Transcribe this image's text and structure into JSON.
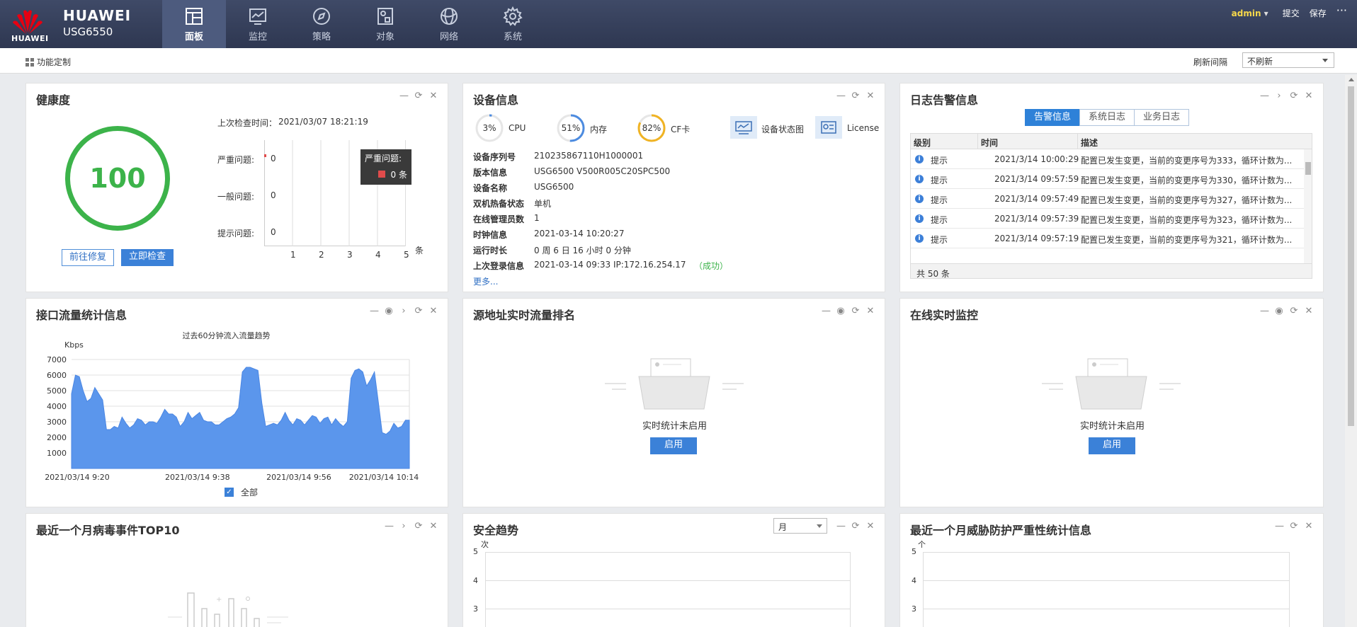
{
  "header": {
    "brand_logo": "HUAWEI",
    "brand_name": "HUAWEI",
    "model": "USG6550",
    "nav": [
      {
        "label": "面板",
        "icon": "dashboard-icon"
      },
      {
        "label": "监控",
        "icon": "monitor-icon"
      },
      {
        "label": "策略",
        "icon": "compass-icon"
      },
      {
        "label": "对象",
        "icon": "object-icon"
      },
      {
        "label": "网络",
        "icon": "globe-icon"
      },
      {
        "label": "系统",
        "icon": "gear-icon"
      }
    ],
    "user": "admin",
    "submit": "提交",
    "save": "保存",
    "more": "···"
  },
  "toolbar": {
    "customize": "功能定制",
    "refresh_label": "刷新间隔",
    "refresh_value": "不刷新"
  },
  "health": {
    "title": "健康度",
    "score": "100",
    "last_check_label": "上次检查时间：",
    "last_check": "2021/03/07 18:21:19",
    "rows": [
      {
        "label": "严重问题:",
        "count": "0"
      },
      {
        "label": "一般问题:",
        "count": "0"
      },
      {
        "label": "提示问题:",
        "count": "0"
      }
    ],
    "axis": [
      "1",
      "2",
      "3",
      "4",
      "5"
    ],
    "axis_unit": "条",
    "tooltip_title": "严重问题:",
    "tooltip_value": "0 条",
    "fix_button": "前往修复",
    "check_button": "立即检查"
  },
  "device": {
    "title": "设备信息",
    "cpu": {
      "value": "3%",
      "label": "CPU",
      "pct": 3
    },
    "mem": {
      "value": "51%",
      "label": "内存",
      "pct": 51
    },
    "cf": {
      "value": "82%",
      "label": "CF卡",
      "pct": 82
    },
    "status_label": "设备状态图",
    "license_label": "License",
    "rows": [
      {
        "k": "设备序列号",
        "v": "210235867110H1000001"
      },
      {
        "k": "版本信息",
        "v": "USG6500 V500R005C20SPC500"
      },
      {
        "k": "设备名称",
        "v": "USG6500"
      },
      {
        "k": "双机热备状态",
        "v": "单机"
      },
      {
        "k": "在线管理员数",
        "v": "1"
      },
      {
        "k": "时钟信息",
        "v": "2021-03-14 10:20:27"
      },
      {
        "k": "运行时长",
        "v": "0 周 6 日 16 小时 0 分钟"
      },
      {
        "k": "上次登录信息",
        "v": "2021-03-14 09:33 IP:172.16.254.17"
      }
    ],
    "login_status": "（成功）",
    "more": "更多..."
  },
  "logs": {
    "title": "日志告警信息",
    "tabs": [
      "告警信息",
      "系统日志",
      "业务日志"
    ],
    "headers": [
      "级别",
      "时间",
      "描述"
    ],
    "rows": [
      {
        "level": "提示",
        "time": "2021/3/14 10:00:29",
        "desc": "配置已发生变更，当前的变更序号为333，循环计数为..."
      },
      {
        "level": "提示",
        "time": "2021/3/14 09:57:59",
        "desc": "配置已发生变更，当前的变更序号为330，循环计数为..."
      },
      {
        "level": "提示",
        "time": "2021/3/14 09:57:49",
        "desc": "配置已发生变更，当前的变更序号为327，循环计数为..."
      },
      {
        "level": "提示",
        "time": "2021/3/14 09:57:39",
        "desc": "配置已发生变更，当前的变更序号为323，循环计数为..."
      },
      {
        "level": "提示",
        "time": "2021/3/14 09:57:19",
        "desc": "配置已发生变更，当前的变更序号为321，循环计数为..."
      }
    ],
    "total": "共 50 条"
  },
  "traffic": {
    "title": "接口流量统计信息",
    "legend": "全部"
  },
  "chart_data": {
    "type": "area",
    "title": "过去60分钟流入流量趋势",
    "ylabel": "Kbps",
    "ylim": [
      0,
      7000
    ],
    "yticks": [
      "7000",
      "6000",
      "5000",
      "4000",
      "3000",
      "2000",
      "1000"
    ],
    "xticks": [
      "2021/03/14 9:20",
      "2021/03/14 9:38",
      "2021/03/14 9:56",
      "2021/03/14 10:14"
    ],
    "series": [
      {
        "name": "全部",
        "color": "#5b96ec",
        "values": [
          4800,
          6000,
          5900,
          5000,
          4300,
          4500,
          5200,
          4800,
          4400,
          2500,
          2500,
          2700,
          2600,
          3300,
          2900,
          2600,
          2800,
          3200,
          3100,
          2800,
          3000,
          3000,
          2900,
          3300,
          3800,
          3500,
          3500,
          3300,
          2700,
          3000,
          3600,
          3200,
          3400,
          3600,
          3100,
          3000,
          3000,
          2800,
          2800,
          3000,
          3200,
          3300,
          3500,
          3900,
          6200,
          6500,
          6500,
          6400,
          6300,
          4200,
          2700,
          2800,
          2900,
          2800,
          3100,
          3600,
          3100,
          2800,
          3200,
          3100,
          2800,
          3100,
          3400,
          3300,
          2900,
          3200,
          3300,
          2800,
          3200,
          2900,
          2700,
          3000,
          5800,
          6300,
          6400,
          6200,
          5300,
          5700,
          6200,
          4300,
          2300,
          2200,
          2400,
          2900,
          2600,
          2700,
          3100,
          3100
        ]
      }
    ]
  },
  "source_rank": {
    "title": "源地址实时流量排名",
    "empty_text": "实时统计未启用",
    "enable_button": "启用"
  },
  "online_monitor": {
    "title": "在线实时监控",
    "empty_text": "实时统计未启用",
    "enable_button": "启用"
  },
  "virus": {
    "title": "最近一个月病毒事件TOP10"
  },
  "security": {
    "title": "安全趋势",
    "range": "月",
    "y_unit": "次",
    "yticks": [
      "5",
      "4",
      "3"
    ]
  },
  "threat": {
    "title": "最近一个月威胁防护严重性统计信息",
    "y_unit": "个",
    "yticks": [
      "5",
      "4",
      "3"
    ]
  }
}
